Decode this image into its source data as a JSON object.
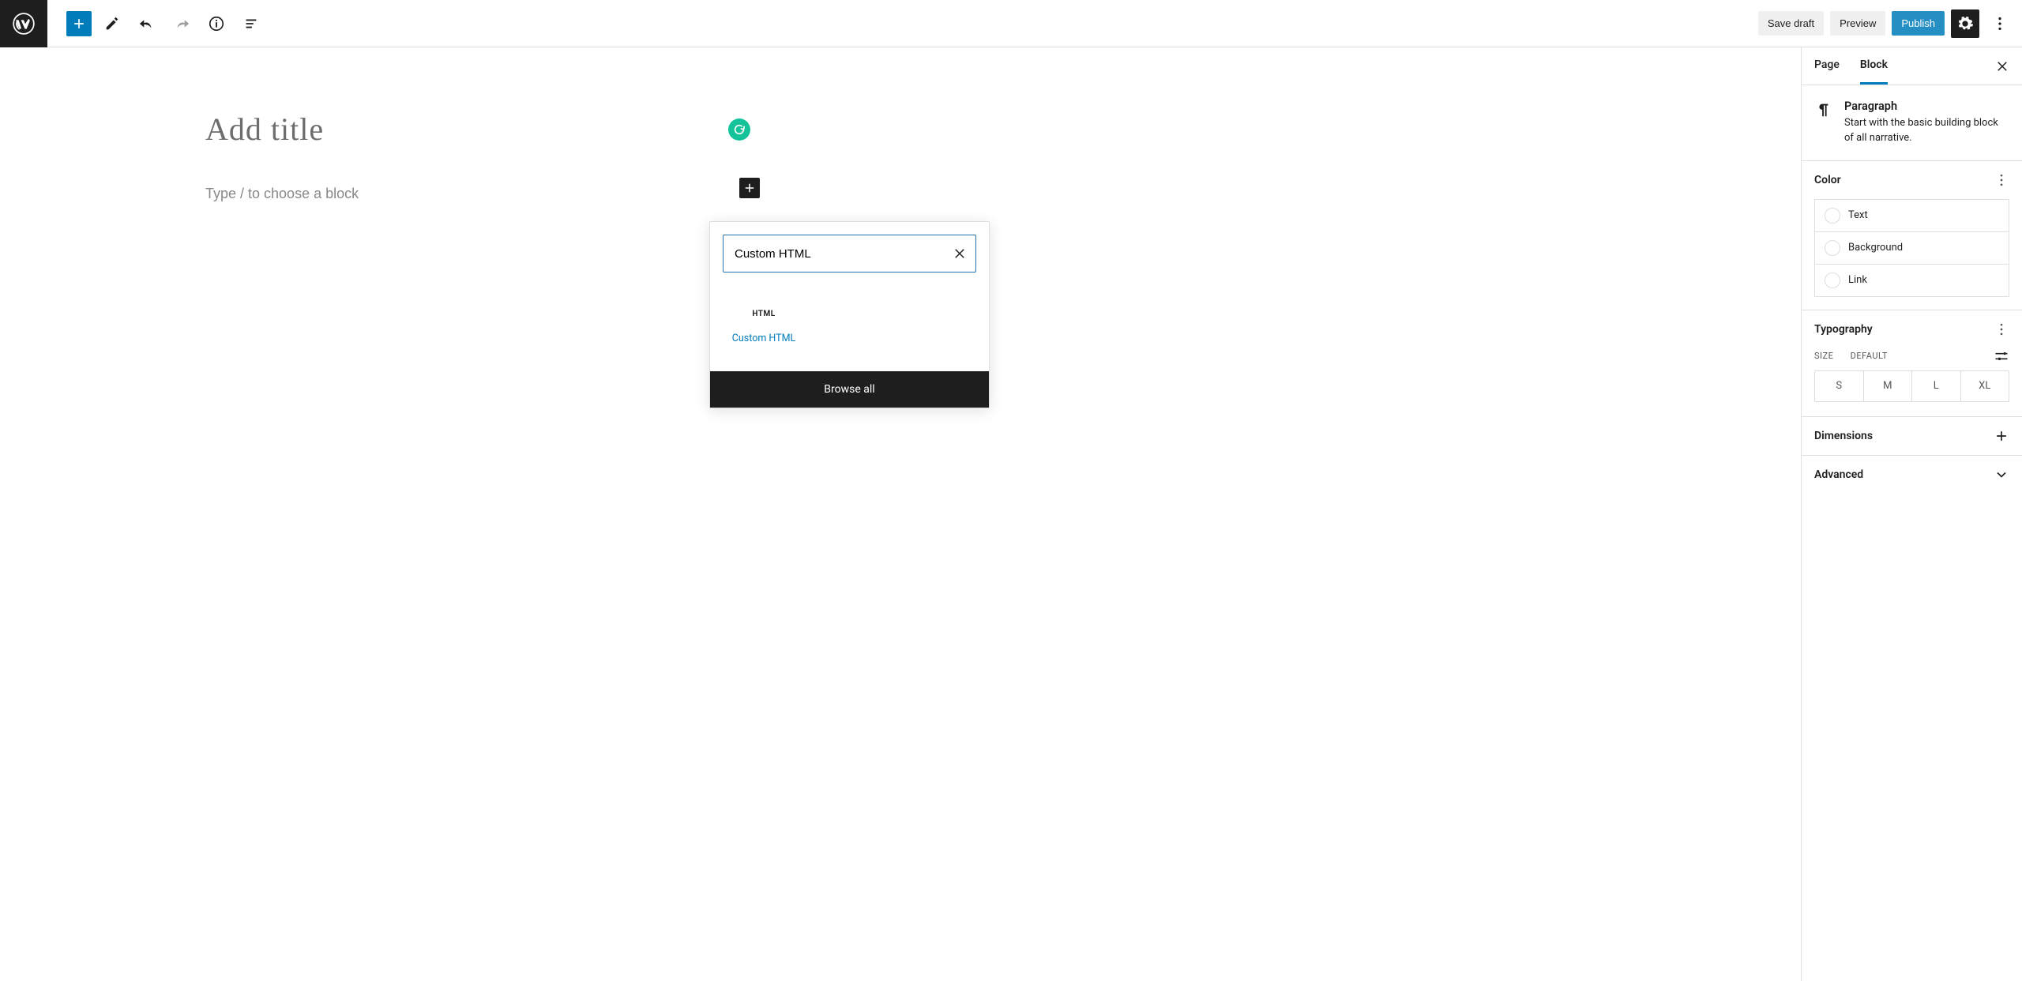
{
  "toolbar": {
    "save_draft": "Save draft",
    "preview": "Preview",
    "publish": "Publish"
  },
  "canvas": {
    "title_placeholder": "Add title",
    "paragraph_placeholder": "Type / to choose a block"
  },
  "inserter": {
    "search_value": "Custom HTML",
    "result_icon_text": "HTML",
    "result_label": "Custom HTML",
    "browse_all": "Browse all"
  },
  "sidebar": {
    "tabs": {
      "page": "Page",
      "block": "Block"
    },
    "block_info": {
      "title": "Paragraph",
      "description": "Start with the basic building block of all narrative."
    },
    "panels": {
      "color": {
        "title": "Color",
        "rows": {
          "text": "Text",
          "background": "Background",
          "link": "Link"
        }
      },
      "typography": {
        "title": "Typography",
        "size_label": "SIZE",
        "size_default": "DEFAULT",
        "sizes": {
          "s": "S",
          "m": "M",
          "l": "L",
          "xl": "XL"
        }
      },
      "dimensions": {
        "title": "Dimensions"
      },
      "advanced": {
        "title": "Advanced"
      }
    }
  }
}
